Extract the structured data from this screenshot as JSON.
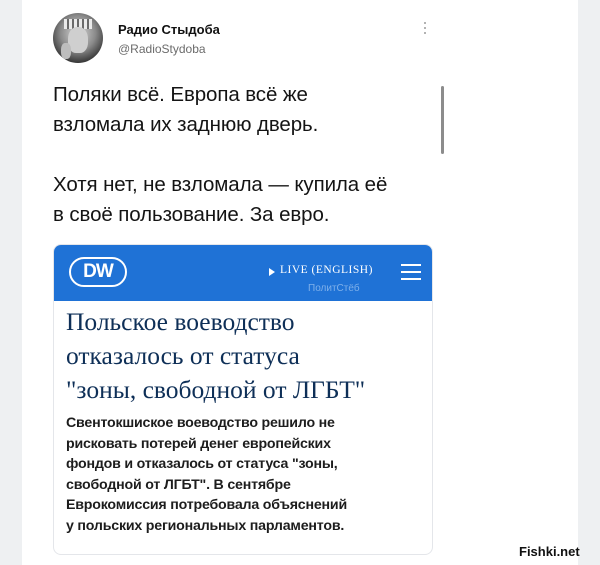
{
  "account": {
    "name": "Радио Стыдоба",
    "handle": "@RadioStydoba"
  },
  "tweet": {
    "line1": "Поляки всё. Европа всё же",
    "line2": "взломала их заднюю дверь.",
    "line3": "Хотя нет, не взломала — купила её",
    "line4": "в своё пользование. За евро."
  },
  "dw": {
    "logo": "DW",
    "live": "LIVE (ENGLISH)",
    "watermark": "ПолитСтёб",
    "headline1": "Польское воеводство",
    "headline2": "отказалось от статуса",
    "headline3": "\"зоны, свободной от ЛГБТ\"",
    "summary1": "Свентокшиское воеводство решило не",
    "summary2": "рисковать потерей денег европейских",
    "summary3": "фондов и отказалось от статуса \"зоны,",
    "summary4": "свободной от ЛГБТ\". В сентябре",
    "summary5": "Еврокомиссия потребовала объяснений",
    "summary6": "у польских региональных парламентов."
  },
  "site_watermark": "Fishki.net",
  "colors": {
    "dw_blue": "#1f72d6",
    "headline": "#0e2f57",
    "page_side": "#eef0f2"
  }
}
